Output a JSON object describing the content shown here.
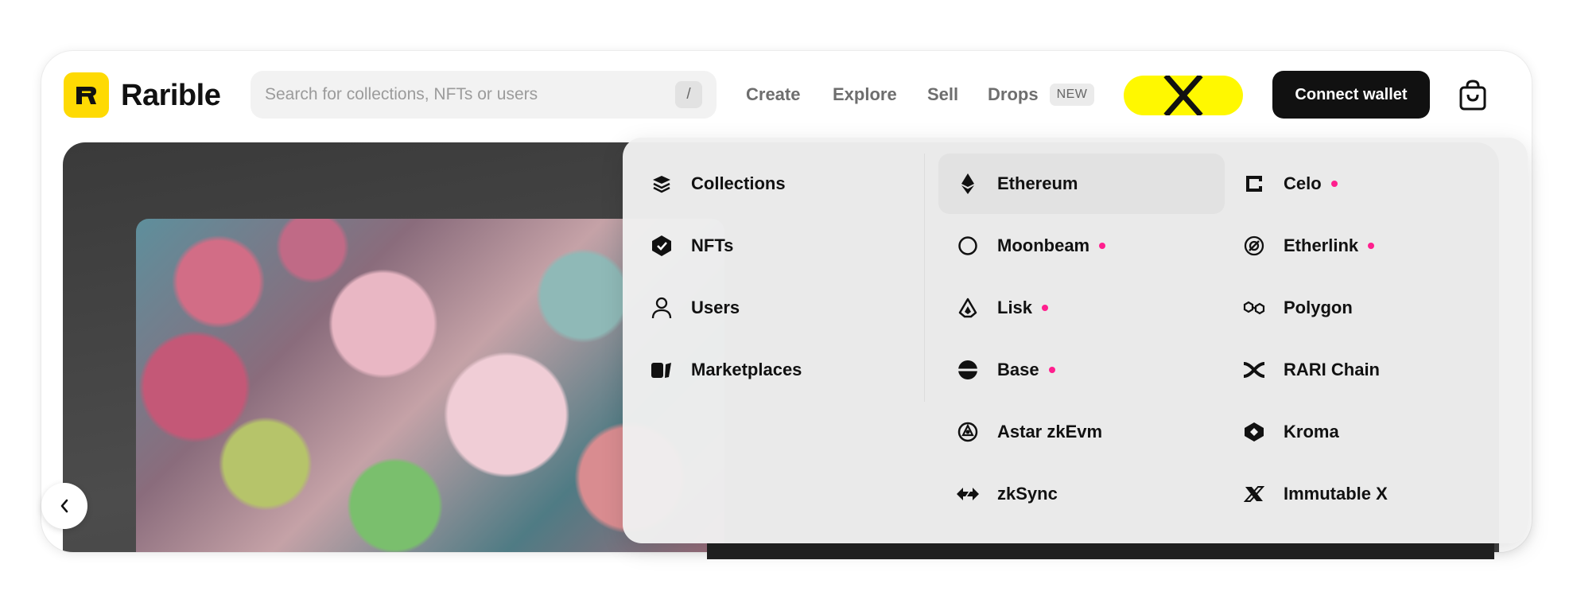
{
  "header": {
    "brand_name": "Rarible",
    "search_placeholder": "Search for collections, NFTs or users",
    "search_shortcut": "/",
    "nav": [
      "Create",
      "Explore",
      "Sell",
      "Drops"
    ],
    "drops_badge": "NEW",
    "connect_wallet_label": "Connect wallet",
    "accent_color": "#FEDA03",
    "promo_color": "#FFF800"
  },
  "dropdown": {
    "categories": [
      {
        "label": "Collections",
        "icon": "layers-icon"
      },
      {
        "label": "NFTs",
        "icon": "hexagon-check-icon"
      },
      {
        "label": "Users",
        "icon": "user-icon"
      },
      {
        "label": "Marketplaces",
        "icon": "marketplace-icon"
      }
    ],
    "chains_left": [
      {
        "label": "Ethereum",
        "icon": "ethereum-icon",
        "new": false,
        "selected": true
      },
      {
        "label": "Moonbeam",
        "icon": "moonbeam-icon",
        "new": true
      },
      {
        "label": "Lisk",
        "icon": "lisk-icon",
        "new": true
      },
      {
        "label": "Base",
        "icon": "base-icon",
        "new": true
      },
      {
        "label": "Astar zkEvm",
        "icon": "astar-icon",
        "new": false
      },
      {
        "label": "zkSync",
        "icon": "zksync-icon",
        "new": false
      }
    ],
    "chains_right": [
      {
        "label": "Celo",
        "icon": "celo-icon",
        "new": true
      },
      {
        "label": "Etherlink",
        "icon": "etherlink-icon",
        "new": true
      },
      {
        "label": "Polygon",
        "icon": "polygon-icon",
        "new": false
      },
      {
        "label": "RARI Chain",
        "icon": "rari-chain-icon",
        "new": false
      },
      {
        "label": "Kroma",
        "icon": "kroma-icon",
        "new": false
      },
      {
        "label": "Immutable X",
        "icon": "immutable-x-icon",
        "new": false
      }
    ],
    "new_dot_color": "#FF1F8E"
  }
}
